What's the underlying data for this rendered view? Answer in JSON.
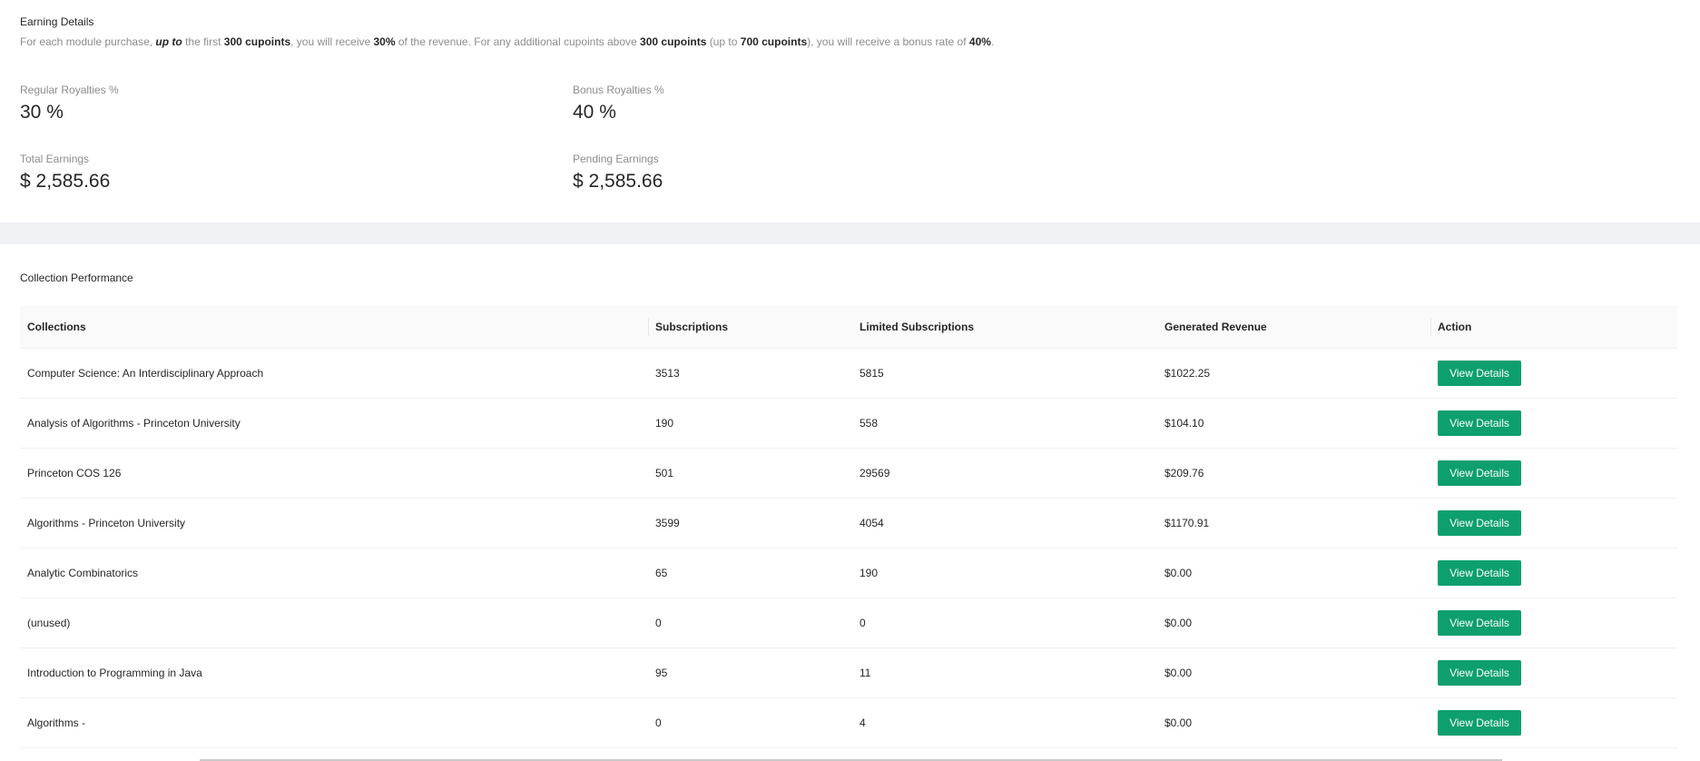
{
  "earning_details": {
    "title": "Earning Details",
    "description": {
      "t1": "For each module purchase, ",
      "t2": "up to",
      "t3": " the first ",
      "t4": "300 cupoints",
      "t5": ", you will receive ",
      "t6": "30%",
      "t7": " of the revenue. For any additional cupoints above ",
      "t8": "300 cupoints",
      "t9": " (up to ",
      "t10": "700 cupoints",
      "t11": "), you will receive a bonus rate of ",
      "t12": "40%",
      "t13": "."
    },
    "regular_royalties": {
      "label": "Regular Royalties %",
      "value": "30 %"
    },
    "bonus_royalties": {
      "label": "Bonus Royalties %",
      "value": "40 %"
    },
    "total_earnings": {
      "label": "Total Earnings",
      "value": "$ 2,585.66"
    },
    "pending_earnings": {
      "label": "Pending Earnings",
      "value": "$ 2,585.66"
    }
  },
  "collection_performance": {
    "title": "Collection Performance",
    "columns": [
      "Collections",
      "Subscriptions",
      "Limited Subscriptions",
      "Generated Revenue",
      "Action"
    ],
    "rows": [
      {
        "name": "Computer Science: An Interdisciplinary Approach",
        "subscriptions": "3513",
        "limited": "5815",
        "revenue": "$1022.25",
        "action": "View Details"
      },
      {
        "name": "Analysis of Algorithms - Princeton University",
        "subscriptions": "190",
        "limited": "558",
        "revenue": "$104.10",
        "action": "View Details"
      },
      {
        "name": "Princeton COS 126",
        "subscriptions": "501",
        "limited": "29569",
        "revenue": "$209.76",
        "action": "View Details"
      },
      {
        "name": "Algorithms - Princeton University",
        "subscriptions": "3599",
        "limited": "4054",
        "revenue": "$1170.91",
        "action": "View Details"
      },
      {
        "name": "Analytic Combinatorics",
        "subscriptions": "65",
        "limited": "190",
        "revenue": "$0.00",
        "action": "View Details"
      },
      {
        "name": "(unused)",
        "subscriptions": "0",
        "limited": "0",
        "revenue": "$0.00",
        "action": "View Details"
      },
      {
        "name": "Introduction to Programming in Java",
        "subscriptions": "95",
        "limited": "11",
        "revenue": "$0.00",
        "action": "View Details"
      },
      {
        "name": "Algorithms -",
        "subscriptions": "0",
        "limited": "4",
        "revenue": "$0.00",
        "action": "View Details"
      }
    ]
  },
  "colors": {
    "button": "#0e9f6e",
    "band": "#f0f2f5",
    "header_bg": "#fafafa"
  }
}
